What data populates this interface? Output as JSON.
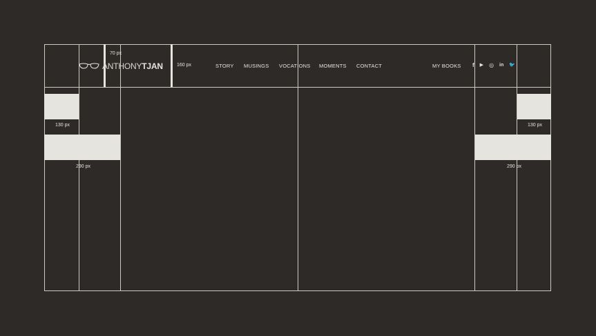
{
  "logo": {
    "first": "ANTHONY",
    "last": "TJAN"
  },
  "nav": [
    "STORY",
    "MUSINGS",
    "VOCATIONS",
    "MOMENTS",
    "CONTACT"
  ],
  "my_books": "MY BOOKS",
  "social": [
    "f",
    "▶",
    "◎",
    "in",
    "🐦"
  ],
  "dimensions": {
    "px70": "70 px",
    "px160": "160 px",
    "px130_left": "130 px",
    "px130_right": "130 px",
    "px290_left": "290 px",
    "px290_right": "290 px"
  }
}
